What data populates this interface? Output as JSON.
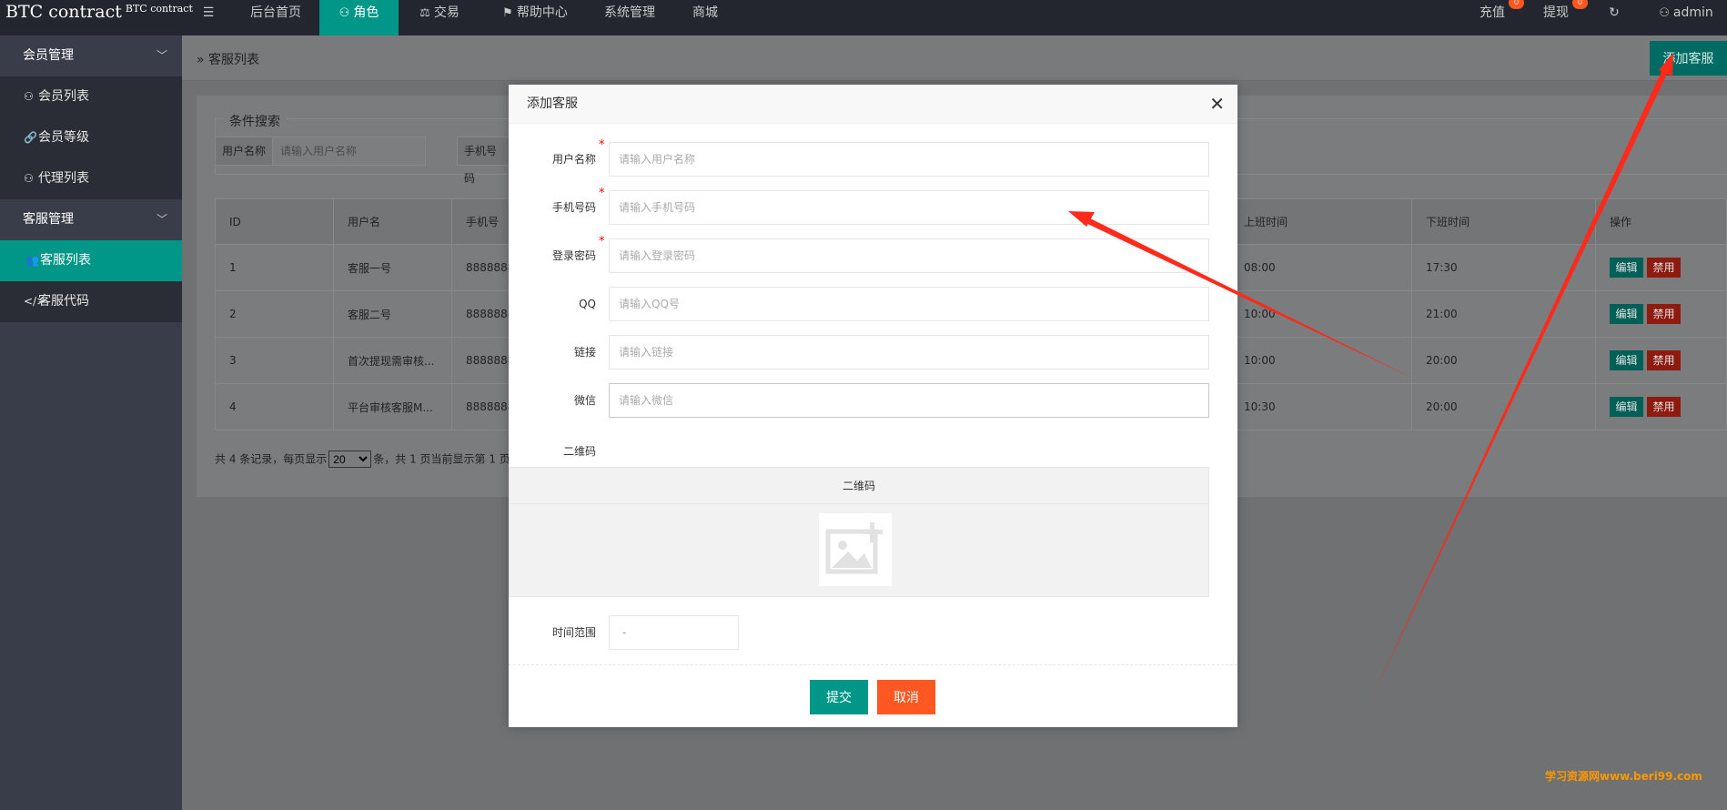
{
  "header": {
    "logo": "BTC contract",
    "logo_sup": "BTC contract",
    "menu_toggle_icon": "menu-fold-icon",
    "nav": [
      {
        "label": "后台首页",
        "icon": ""
      },
      {
        "label": "角色",
        "icon": "user-icon"
      },
      {
        "label": "交易",
        "icon": "scale-icon"
      },
      {
        "label": "帮助中心",
        "icon": "flag-icon"
      },
      {
        "label": "系统管理",
        "icon": ""
      },
      {
        "label": "商城",
        "icon": ""
      }
    ],
    "recharge": {
      "label": "充值",
      "badge": "0"
    },
    "withdraw": {
      "label": "提现",
      "badge": "0"
    },
    "refresh_icon": "refresh-icon",
    "user": "admin"
  },
  "sidebar": {
    "groups": [
      {
        "label": "会员管理",
        "items": [
          "会员列表",
          "会员等级",
          "代理列表"
        ]
      },
      {
        "label": "客服管理",
        "items": [
          "客服列表",
          "客服代码"
        ]
      }
    ]
  },
  "page": {
    "breadcrumb": "客服列表",
    "add_button": "添加客服",
    "search_legend": "条件搜索",
    "search": [
      {
        "label": "用户名称",
        "placeholder": "请输入用户名称"
      },
      {
        "label": "手机号码",
        "placeholder": ""
      }
    ],
    "table": {
      "columns": [
        "ID",
        "用户名",
        "手机号",
        "上班时间",
        "下班时间",
        "操作"
      ],
      "rows": [
        [
          "1",
          "客服一号",
          "8888888",
          "08:00",
          "17:30"
        ],
        [
          "2",
          "客服二号",
          "8888888",
          "10:00",
          "21:00"
        ],
        [
          "3",
          "首次提现需审核...",
          "8888888",
          "10:00",
          "20:00"
        ],
        [
          "4",
          "平台审核客服M...",
          "8888888",
          "10:30",
          "20:00"
        ]
      ],
      "edit_label": "编辑",
      "ban_label": "禁用"
    },
    "pager": {
      "prefix": "共 4 条记录，每页显示",
      "page_size": "20",
      "suffix": "条，共 1 页当前显示第 1 页"
    }
  },
  "modal": {
    "title": "添加客服",
    "fields": [
      {
        "label": "用户名称",
        "placeholder": "请输入用户名称",
        "required": "*"
      },
      {
        "label": "手机号码",
        "placeholder": "请输入手机号码",
        "required": "*"
      },
      {
        "label": "登录密码",
        "placeholder": "请输入登录密码",
        "required": "*"
      },
      {
        "label": "QQ",
        "placeholder": "请输入QQ号",
        "required": ""
      },
      {
        "label": "链接",
        "placeholder": "请输入链接",
        "required": ""
      },
      {
        "label": "微信",
        "placeholder": "请输入微信",
        "required": ""
      }
    ],
    "qr_label": "二维码",
    "qr_title": "二维码",
    "qr_icon": "image-add-icon",
    "time_label": "时间范围",
    "time_value": "-",
    "submit": "提交",
    "cancel": "取消"
  },
  "watermark": "学习资源网www.beri99.com",
  "annotation_color": "#ff2a1a"
}
